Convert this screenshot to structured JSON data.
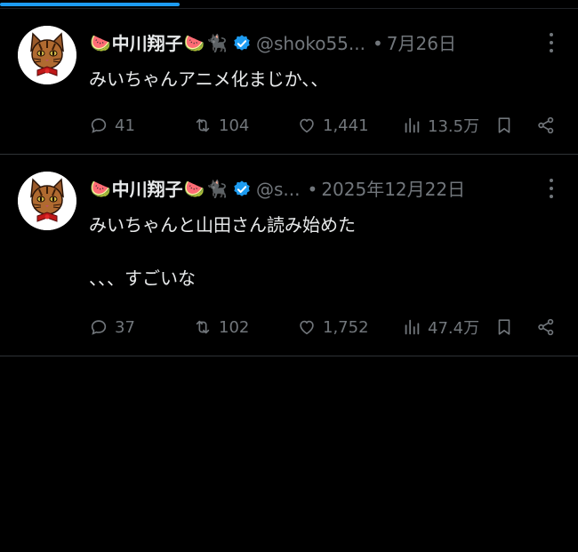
{
  "progress": {
    "fraction": 0.31,
    "color": "#1d9bf0"
  },
  "posts": [
    {
      "emoji_left": "🍉",
      "name": "中川翔子",
      "emoji_right": "🍉",
      "emoji_cat": "🐈‍⬛",
      "handle": "@shoko55...",
      "dot": "•",
      "date": "7月26日",
      "text": "みいちゃんアニメ化まじか、、",
      "replies": "41",
      "reposts": "104",
      "likes": "1,441",
      "views": "13.5万"
    },
    {
      "emoji_left": "🍉",
      "name": "中川翔子",
      "emoji_right": "🍉",
      "emoji_cat": "🐈‍⬛",
      "handle": "@s...",
      "dot": "•",
      "date": "2025年12月22日",
      "text": "みいちゃんと山田さん読み始めた\n\n、、、すごいな",
      "replies": "37",
      "reposts": "102",
      "likes": "1,752",
      "views": "47.4万"
    }
  ],
  "colors": {
    "background": "#000000",
    "text": "#e7e9ea",
    "muted": "#71767b",
    "verified": "#1d9bf0",
    "divider": "#2f3336"
  },
  "icons": [
    "reply-icon",
    "repost-icon",
    "like-icon",
    "views-icon",
    "bookmark-icon",
    "share-icon",
    "more-icon",
    "verified-icon",
    "avatar-cat"
  ]
}
